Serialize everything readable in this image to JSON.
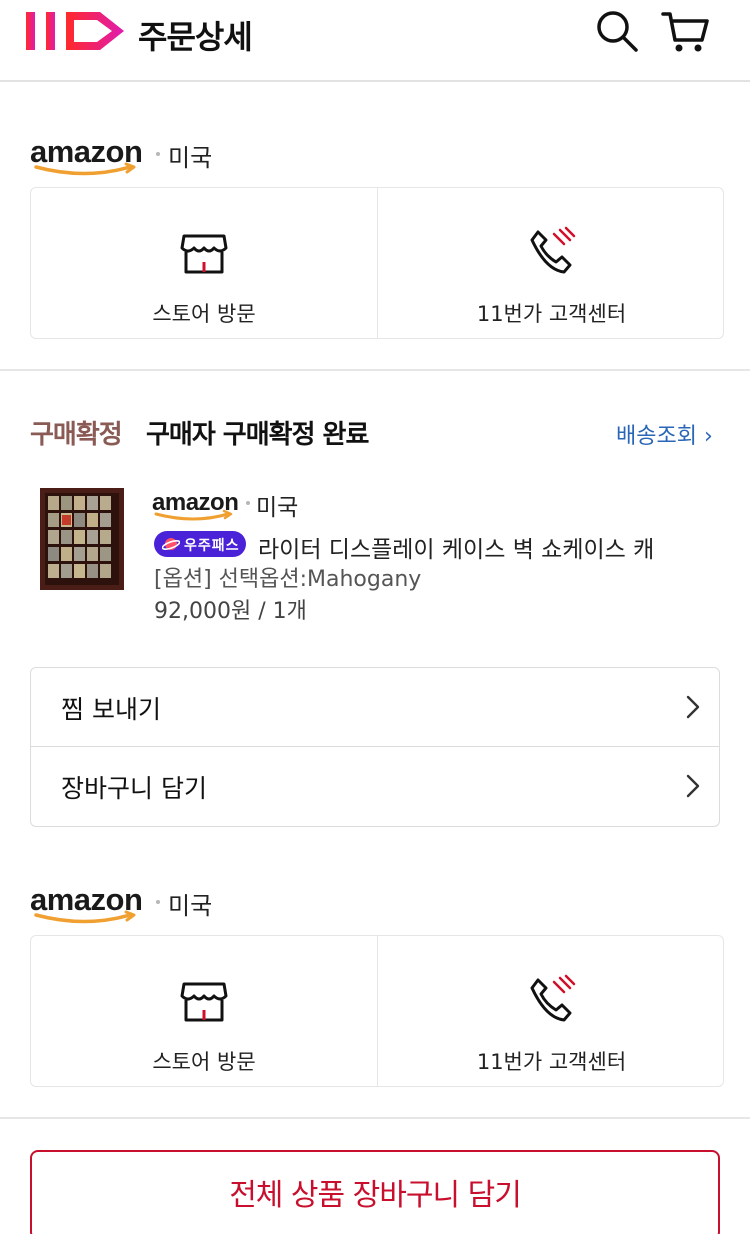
{
  "header": {
    "title": "주문상세",
    "logo_icon": "11st-logo",
    "search_icon": "search-icon",
    "cart_icon": "cart-icon"
  },
  "seller_top": {
    "brand": "amazon",
    "country": "미국",
    "store_visit_label": "스토어 방문",
    "customer_center_label": "11번가 고객센터"
  },
  "order": {
    "status_label": "구매확정",
    "status_text": "구매자 구매확정 완료",
    "tracking_link": "배송조회 ›",
    "product": {
      "brand": "amazon",
      "country": "미국",
      "badge": "우주패스",
      "name": "라이터 디스플레이 케이스 벽 쇼케이스 캐",
      "option": "[옵션] 선택옵션:Mahogany",
      "price": "92,000원 / 1개"
    }
  },
  "actions": [
    {
      "label": "찜 보내기"
    },
    {
      "label": "장바구니 담기"
    }
  ],
  "seller_bottom": {
    "brand": "amazon",
    "country": "미국",
    "store_visit_label": "스토어 방문",
    "customer_center_label": "11번가 고객센터"
  },
  "cta": {
    "label": "전체 상품 장바구니 담기"
  },
  "colors": {
    "brand_red": "#c8102e",
    "status_brown": "#8a5a54",
    "link_blue": "#2a66b8",
    "badge_purple": "#4a23d8",
    "amazon_orange": "#f0a030"
  }
}
